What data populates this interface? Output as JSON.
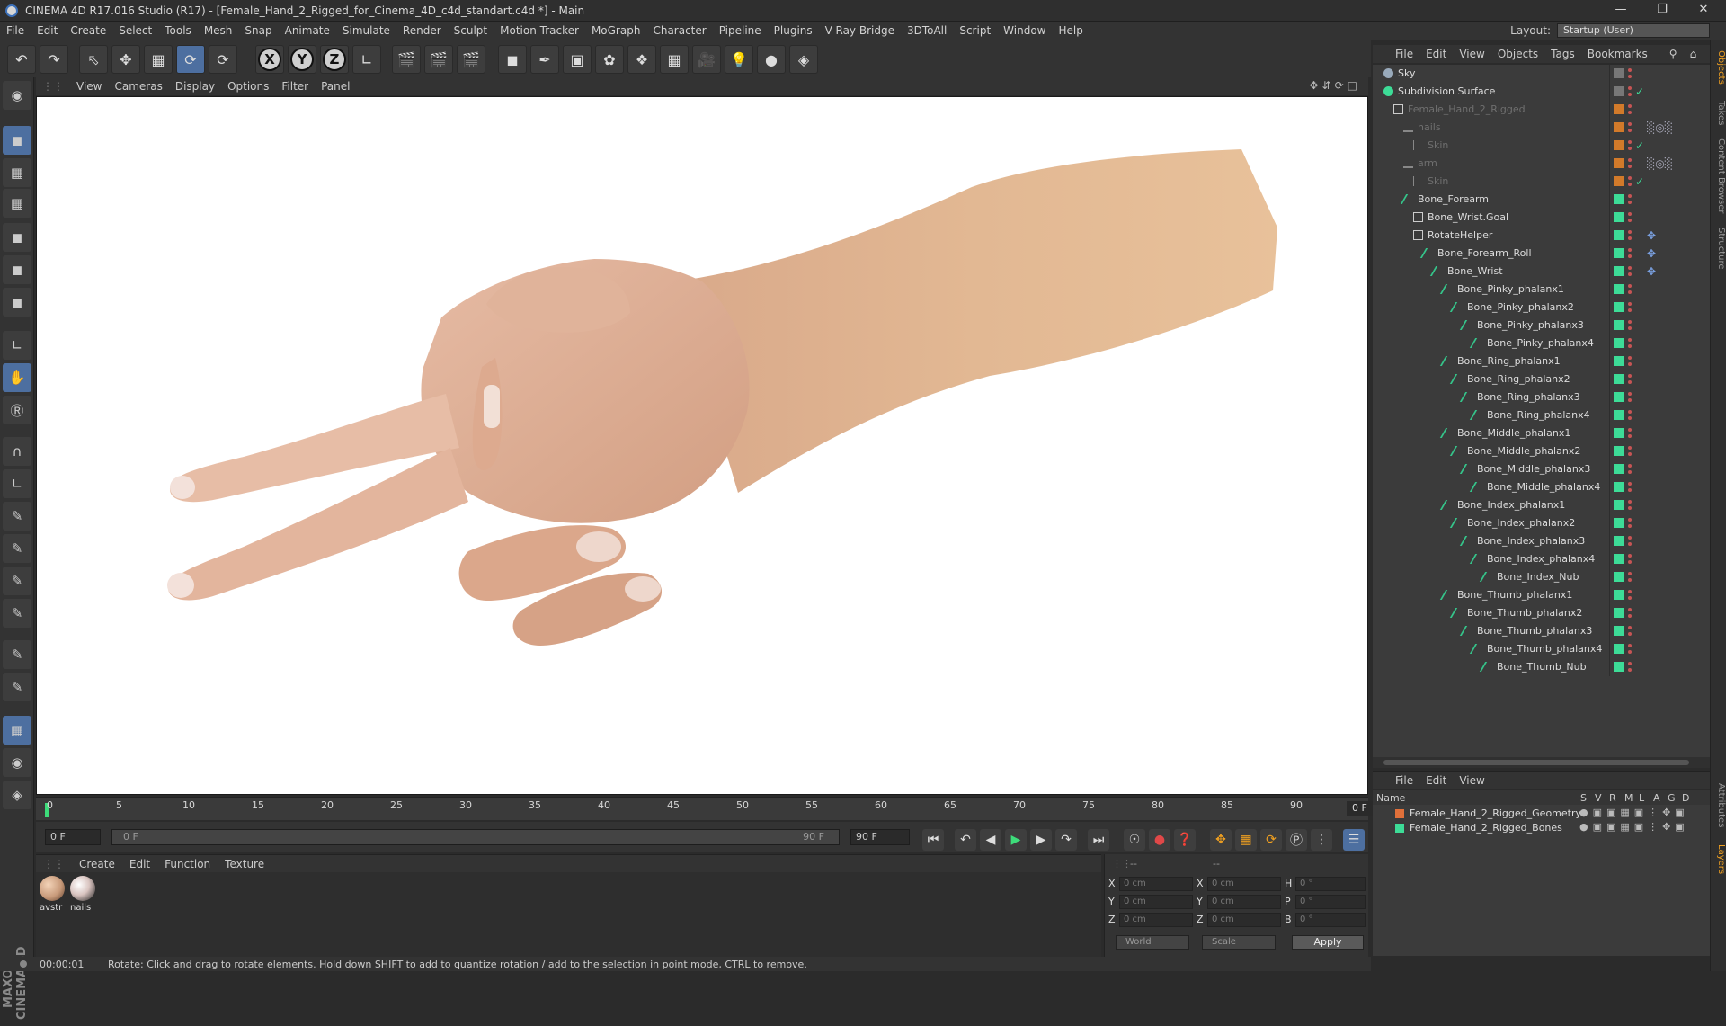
{
  "window": {
    "title": "CINEMA 4D R17.016 Studio (R17) - [Female_Hand_2_Rigged_for_Cinema_4D_c4d_standart.c4d *] - Main"
  },
  "menu": [
    "File",
    "Edit",
    "Create",
    "Select",
    "Tools",
    "Mesh",
    "Snap",
    "Animate",
    "Simulate",
    "Render",
    "Sculpt",
    "Motion Tracker",
    "MoGraph",
    "Character",
    "Pipeline",
    "Plugins",
    "V-Ray Bridge",
    "3DToAll",
    "Script",
    "Window",
    "Help"
  ],
  "layout": {
    "label": "Layout:",
    "value": "Startup (User)"
  },
  "toolbar": {
    "axis_x": "X",
    "axis_y": "Y",
    "axis_z": "Z"
  },
  "viewport": {
    "menu": [
      "View",
      "Cameras",
      "Display",
      "Options",
      "Filter",
      "Panel"
    ]
  },
  "timeline": {
    "ticks": [
      "0",
      "5",
      "10",
      "15",
      "20",
      "25",
      "30",
      "35",
      "40",
      "45",
      "50",
      "55",
      "60",
      "65",
      "70",
      "75",
      "80",
      "85",
      "90"
    ],
    "current": "0 F"
  },
  "playback": {
    "start": "0 F",
    "range_start": "0 F",
    "range_end": "90 F",
    "end": "90 F"
  },
  "materials": {
    "menu": [
      "Create",
      "Edit",
      "Function",
      "Texture"
    ],
    "items": [
      {
        "name": "avstr",
        "color": "#c89a7a"
      },
      {
        "name": "nails",
        "color": "#d9c4c0"
      }
    ]
  },
  "coords": {
    "x_pos": "0 cm",
    "y_pos": "0 cm",
    "z_pos": "0 cm",
    "x_size": "0 cm",
    "y_size": "0 cm",
    "z_size": "0 cm",
    "h": "0 °",
    "p": "0 °",
    "b": "0 °",
    "mode": "World",
    "scale": "Scale",
    "apply": "Apply",
    "label_x": "X",
    "label_y": "Y",
    "label_z": "Z",
    "label_h": "H",
    "label_p": "P",
    "label_b": "B",
    "dash1": "--",
    "dash2": "--"
  },
  "status": {
    "time": "00:00:01",
    "text": "Rotate: Click and drag to rotate elements. Hold down SHIFT to add to quantize rotation / add to the selection in point mode, CTRL to remove."
  },
  "objects": {
    "menu": [
      "File",
      "Edit",
      "View",
      "Objects",
      "Tags",
      "Bookmarks"
    ],
    "rows": [
      {
        "name": "Sky",
        "indent": 0,
        "dim": false,
        "kind": "sky"
      },
      {
        "name": "Subdivision Surface",
        "indent": 0,
        "dim": false,
        "kind": "subdiv"
      },
      {
        "name": "Female_Hand_2_Rigged",
        "indent": 1,
        "dim": true,
        "kind": "null"
      },
      {
        "name": "nails",
        "indent": 2,
        "dim": true,
        "kind": "mesh"
      },
      {
        "name": "Skin",
        "indent": 3,
        "dim": true,
        "kind": "skin"
      },
      {
        "name": "arm",
        "indent": 2,
        "dim": true,
        "kind": "mesh"
      },
      {
        "name": "Skin",
        "indent": 3,
        "dim": true,
        "kind": "skin"
      },
      {
        "name": "Bone_Forearm",
        "indent": 2,
        "dim": false,
        "kind": "bone"
      },
      {
        "name": "Bone_Wrist.Goal",
        "indent": 3,
        "dim": false,
        "kind": "null"
      },
      {
        "name": "RotateHelper",
        "indent": 3,
        "dim": false,
        "kind": "null"
      },
      {
        "name": "Bone_Forearm_Roll",
        "indent": 4,
        "dim": false,
        "kind": "bone"
      },
      {
        "name": "Bone_Wrist",
        "indent": 5,
        "dim": false,
        "kind": "bone"
      },
      {
        "name": "Bone_Pinky_phalanx1",
        "indent": 6,
        "dim": false,
        "kind": "bone"
      },
      {
        "name": "Bone_Pinky_phalanx2",
        "indent": 7,
        "dim": false,
        "kind": "bone"
      },
      {
        "name": "Bone_Pinky_phalanx3",
        "indent": 8,
        "dim": false,
        "kind": "bone"
      },
      {
        "name": "Bone_Pinky_phalanx4",
        "indent": 9,
        "dim": false,
        "kind": "bone"
      },
      {
        "name": "Bone_Ring_phalanx1",
        "indent": 6,
        "dim": false,
        "kind": "bone"
      },
      {
        "name": "Bone_Ring_phalanx2",
        "indent": 7,
        "dim": false,
        "kind": "bone"
      },
      {
        "name": "Bone_Ring_phalanx3",
        "indent": 8,
        "dim": false,
        "kind": "bone"
      },
      {
        "name": "Bone_Ring_phalanx4",
        "indent": 9,
        "dim": false,
        "kind": "bone"
      },
      {
        "name": "Bone_Middle_phalanx1",
        "indent": 6,
        "dim": false,
        "kind": "bone"
      },
      {
        "name": "Bone_Middle_phalanx2",
        "indent": 7,
        "dim": false,
        "kind": "bone"
      },
      {
        "name": "Bone_Middle_phalanx3",
        "indent": 8,
        "dim": false,
        "kind": "bone"
      },
      {
        "name": "Bone_Middle_phalanx4",
        "indent": 9,
        "dim": false,
        "kind": "bone"
      },
      {
        "name": "Bone_Index_phalanx1",
        "indent": 6,
        "dim": false,
        "kind": "bone"
      },
      {
        "name": "Bone_Index_phalanx2",
        "indent": 7,
        "dim": false,
        "kind": "bone"
      },
      {
        "name": "Bone_Index_phalanx3",
        "indent": 8,
        "dim": false,
        "kind": "bone"
      },
      {
        "name": "Bone_Index_phalanx4",
        "indent": 9,
        "dim": false,
        "kind": "bone"
      },
      {
        "name": "Bone_Index_Nub",
        "indent": 10,
        "dim": false,
        "kind": "bone"
      },
      {
        "name": "Bone_Thumb_phalanx1",
        "indent": 6,
        "dim": false,
        "kind": "bone"
      },
      {
        "name": "Bone_Thumb_phalanx2",
        "indent": 7,
        "dim": false,
        "kind": "bone"
      },
      {
        "name": "Bone_Thumb_phalanx3",
        "indent": 8,
        "dim": false,
        "kind": "bone"
      },
      {
        "name": "Bone_Thumb_phalanx4",
        "indent": 9,
        "dim": false,
        "kind": "bone"
      },
      {
        "name": "Bone_Thumb_Nub",
        "indent": 10,
        "dim": false,
        "kind": "bone"
      }
    ]
  },
  "layers": {
    "menu": [
      "File",
      "Edit",
      "View"
    ],
    "head": {
      "name": "Name",
      "cols": [
        "S",
        "V",
        "R",
        "M",
        "L",
        "A",
        "G",
        "D"
      ]
    },
    "rows": [
      {
        "name": "Female_Hand_2_Rigged_Geometry",
        "color": "#e0703a"
      },
      {
        "name": "Female_Hand_2_Rigged_Bones",
        "color": "#3ddc97"
      }
    ]
  },
  "side_tabs": [
    "Objects",
    "Takes",
    "Content Browser",
    "Structure",
    "Attributes",
    "Layers"
  ],
  "maxon": {
    "l1": "MAXON",
    "l2": "CINEMA 4D"
  }
}
